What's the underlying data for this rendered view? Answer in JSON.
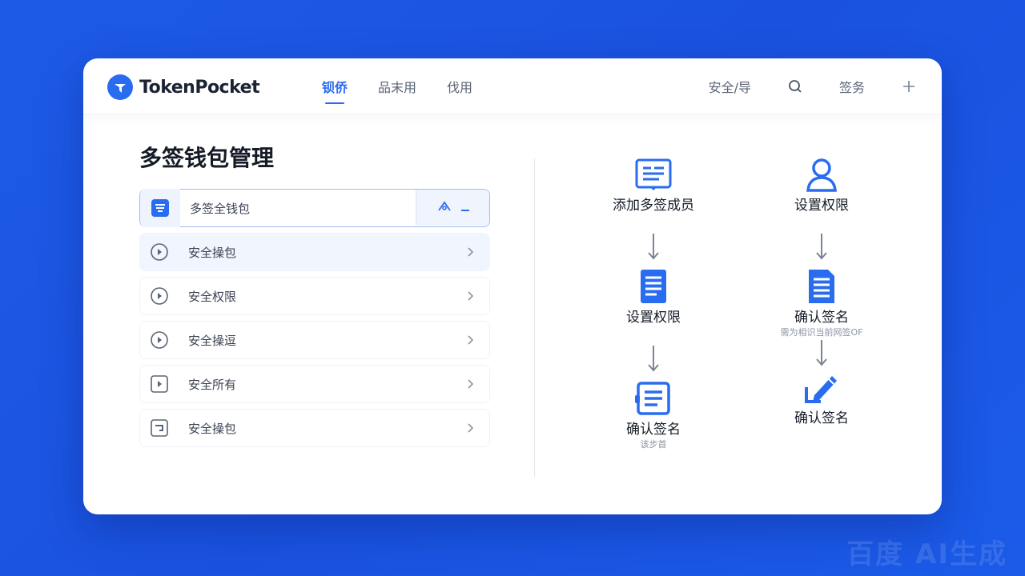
{
  "header": {
    "brand": "TokenPocket",
    "nav": [
      {
        "label": "钡侨",
        "active": true
      },
      {
        "label": "品末用",
        "active": false
      },
      {
        "label": "伐用",
        "active": false
      }
    ],
    "tools": {
      "security_label": "安全/导",
      "sign_label": "签务"
    }
  },
  "main": {
    "title": "多签钱包管理",
    "list": [
      {
        "label": "多签全钱包",
        "icon": "wallet-icon",
        "state": "selected"
      },
      {
        "label": "安全操包",
        "icon": "play-circle-icon",
        "state": "highlight"
      },
      {
        "label": "安全权限",
        "icon": "play-circle-icon",
        "state": "normal"
      },
      {
        "label": "安全操逗",
        "icon": "play-circle-icon",
        "state": "normal"
      },
      {
        "label": "安全所有",
        "icon": "play-square-icon",
        "state": "normal"
      },
      {
        "label": "安全操包",
        "icon": "card-icon",
        "state": "normal"
      }
    ]
  },
  "flow": {
    "left": [
      {
        "label": "添加多签成员",
        "sub": "",
        "icon": "member-card-icon"
      },
      {
        "label": "设置权限",
        "sub": "",
        "icon": "document-icon"
      },
      {
        "label": "确认签名",
        "sub": "该步首",
        "icon": "list-card-icon"
      }
    ],
    "right": [
      {
        "label": "设置权限",
        "sub": "",
        "icon": "user-icon"
      },
      {
        "label": "确认签名",
        "sub": "需为相识当前网签OF",
        "icon": "document-icon"
      },
      {
        "label": "确认签名",
        "sub": "",
        "icon": "pen-sign-icon"
      }
    ]
  },
  "colors": {
    "accent": "#2a6cf0",
    "background": "#1d5be6"
  },
  "watermark": "百度 AI生成"
}
